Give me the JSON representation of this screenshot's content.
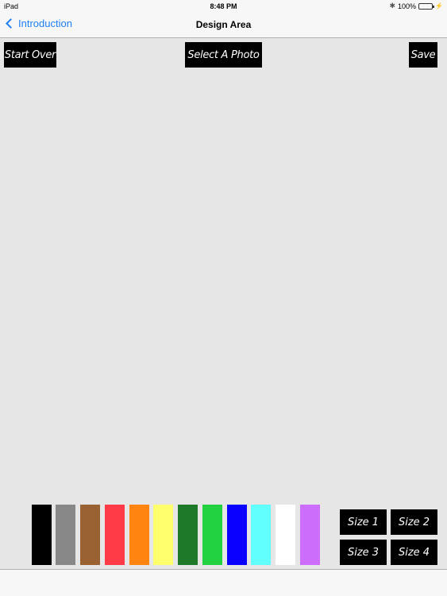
{
  "status_bar": {
    "device": "iPad",
    "time": "8:48 PM",
    "battery": "100%"
  },
  "nav": {
    "back_label": "Introduction",
    "title": "Design Area"
  },
  "toolbar": {
    "start_over": "Start Over",
    "select_photo": "Select A Photo",
    "save": "Save"
  },
  "palette": {
    "colors": [
      "#000000",
      "#888888",
      "#9a6233",
      "#ff3b47",
      "#ff8410",
      "#ffff6e",
      "#1e7a28",
      "#22d241",
      "#0a00ff",
      "#62ffff",
      "#ffffff",
      "#cd6dfb"
    ]
  },
  "sizes": {
    "s1": "Size 1",
    "s2": "Size 2",
    "s3": "Size 3",
    "s4": "Size 4"
  }
}
